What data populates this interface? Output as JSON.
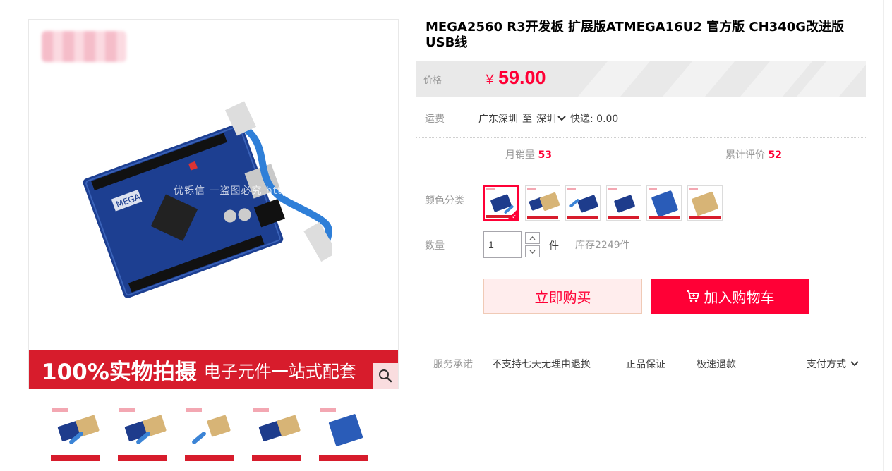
{
  "product": {
    "title": "MEGA2560 R3开发板 扩展版ATMEGA16U2 官方版 CH340G改进版 USB线"
  },
  "gallery": {
    "watermark": "优铄信 一盗图必究 http://ysxem.tmall.com",
    "banner_big": "100%实物拍摄",
    "banner_small": "电子元件一站式配套",
    "zoom_icon": "search-icon",
    "thumbnail_count": 5
  },
  "price": {
    "label": "价格",
    "currency": "￥",
    "value": "59.00",
    "color": "#ff0036"
  },
  "shipping": {
    "label": "运费",
    "from": "广东深圳",
    "to_word": "至",
    "to": "深圳",
    "express": "快递: 0.00"
  },
  "stats": {
    "monthly_sales_label": "月销量",
    "monthly_sales": "53",
    "reviews_label": "累计评价",
    "reviews": "52"
  },
  "sku": {
    "label": "颜色分类",
    "option_count": 6,
    "selected_index": 0
  },
  "quantity": {
    "label": "数量",
    "value": "1",
    "unit": "件",
    "stock": "库存2249件"
  },
  "actions": {
    "buy_now": "立即购买",
    "add_to_cart": "加入购物车"
  },
  "service": {
    "label": "服务承诺",
    "items": [
      "不支持七天无理由退换",
      "正品保证",
      "极速退款"
    ],
    "payment": "支付方式"
  }
}
